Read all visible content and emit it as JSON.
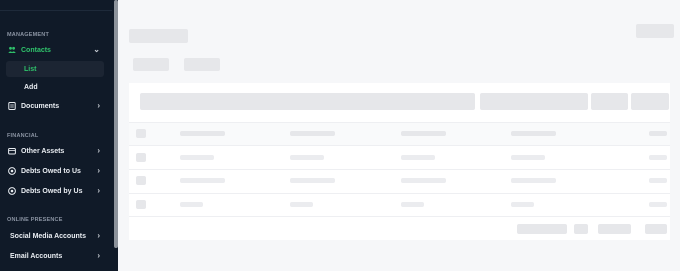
{
  "sidebar": {
    "sections": {
      "management": "MANAGEMENT",
      "financial": "FINANCIAL",
      "online_presence": "ONLINE PRESENCE"
    },
    "items": [
      {
        "label": "Contacts",
        "icon": "users-icon",
        "expanded": true,
        "active": true
      },
      {
        "label": "Documents",
        "icon": "document-icon"
      },
      {
        "label": "Other Assets",
        "icon": "wallet-icon"
      },
      {
        "label": "Debts Owed to Us",
        "icon": "coin-icon"
      },
      {
        "label": "Debts Owed by Us",
        "icon": "coin-icon"
      },
      {
        "label": "Social Media Accounts"
      },
      {
        "label": "Email Accounts"
      }
    ],
    "contacts_sub": [
      {
        "label": "List",
        "selected": true
      },
      {
        "label": "Add"
      }
    ]
  },
  "colors": {
    "sidebar_bg": "#101a28",
    "accent": "#2fc26b",
    "skeleton": "#e6e7ea",
    "page_bg": "#f6f7f9"
  },
  "main": {
    "state": "loading-skeleton",
    "table_skeleton_rows": 3
  }
}
